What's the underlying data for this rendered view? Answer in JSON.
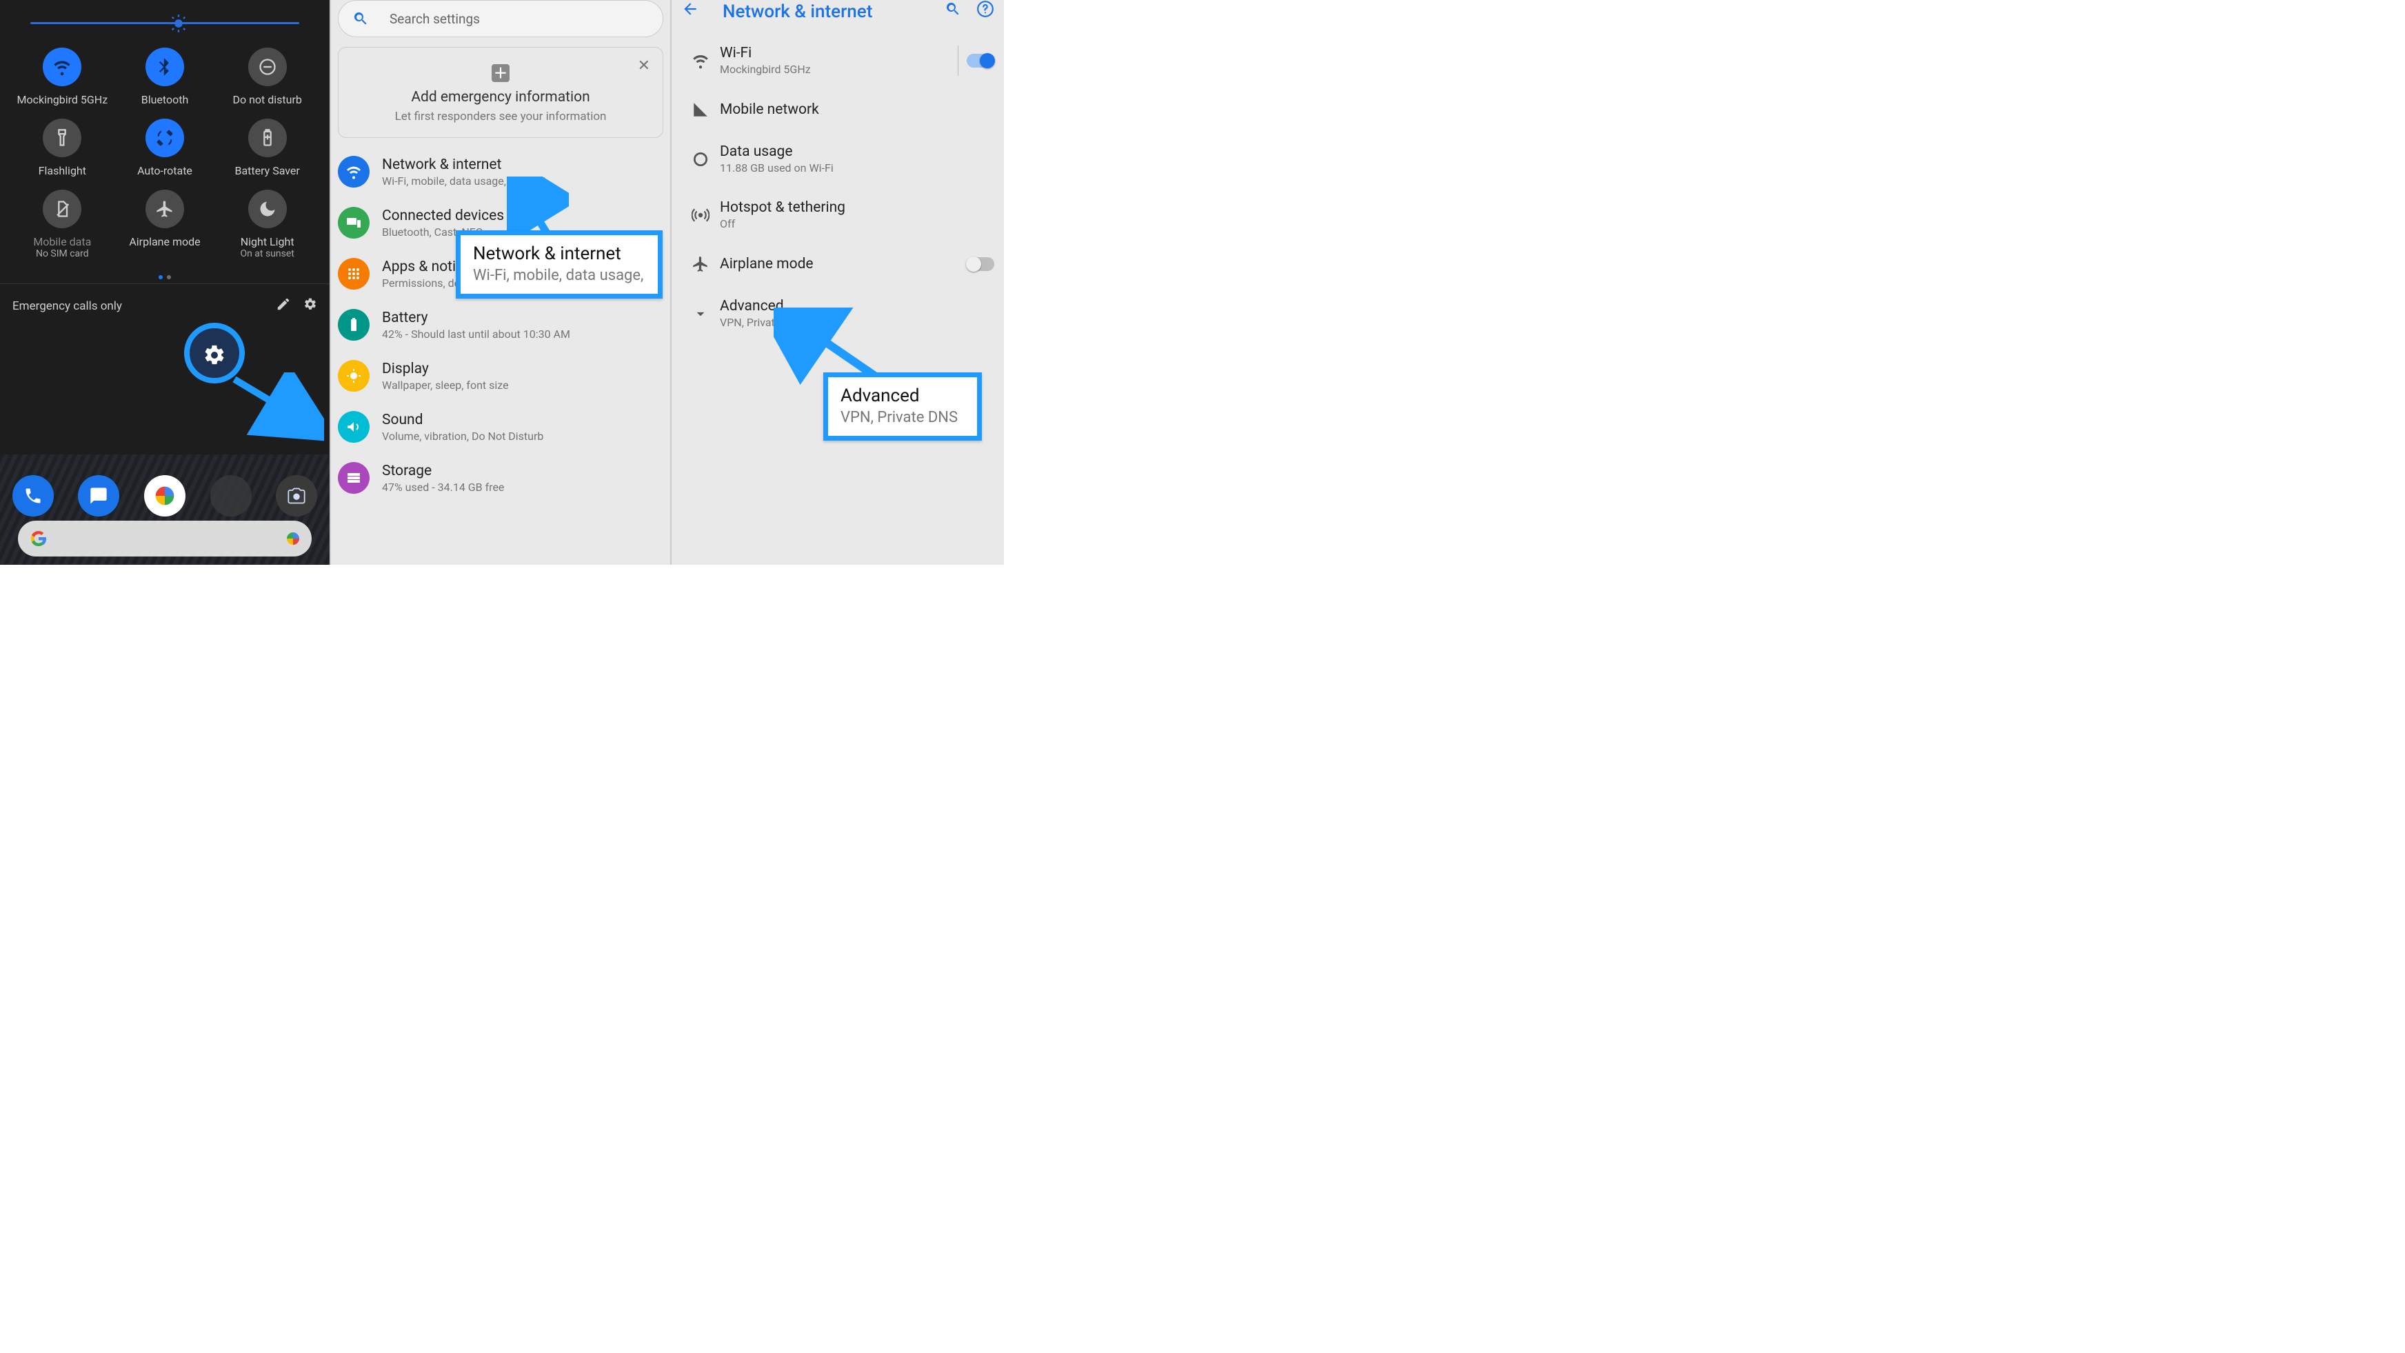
{
  "panel1": {
    "brightness_pct": 55,
    "tiles": [
      {
        "label": "Mockingbird 5GHz",
        "icon": "wifi",
        "on": true
      },
      {
        "label": "Bluetooth",
        "icon": "bluetooth",
        "on": true
      },
      {
        "label": "Do not disturb",
        "icon": "dnd",
        "on": false
      },
      {
        "label": "Flashlight",
        "icon": "flashlight",
        "on": false
      },
      {
        "label": "Auto-rotate",
        "icon": "autorotate",
        "on": true
      },
      {
        "label": "Battery Saver",
        "icon": "battery",
        "on": false
      },
      {
        "label": "Mobile data",
        "sub": "No SIM card",
        "icon": "sim",
        "on": false,
        "dim": true
      },
      {
        "label": "Airplane mode",
        "icon": "airplane",
        "on": false
      },
      {
        "label": "Night Light",
        "sub": "On at sunset",
        "icon": "moon",
        "on": false
      }
    ],
    "footer": "Emergency calls only"
  },
  "panel2": {
    "search_placeholder": "Search settings",
    "emergency": {
      "title": "Add emergency information",
      "subtitle": "Let first responders see your information"
    },
    "rows": [
      {
        "icon": "wifi",
        "color": "#1a73e8",
        "title": "Network & internet",
        "sub": "Wi-Fi, mobile, data usage, hotspot"
      },
      {
        "icon": "devices",
        "color": "#34a853",
        "title": "Connected devices",
        "sub": "Bluetooth, Cast, NFC"
      },
      {
        "icon": "apps",
        "color": "#f57c00",
        "title": "Apps & notifications",
        "sub": "Permissions, default apps"
      },
      {
        "icon": "battery-v",
        "color": "#009688",
        "title": "Battery",
        "sub": "42% - Should last until about 10:30 AM"
      },
      {
        "icon": "display",
        "color": "#fbbc05",
        "title": "Display",
        "sub": "Wallpaper, sleep, font size"
      },
      {
        "icon": "sound",
        "color": "#00bcd4",
        "title": "Sound",
        "sub": "Volume, vibration, Do Not Disturb"
      },
      {
        "icon": "storage",
        "color": "#ab47bc",
        "title": "Storage",
        "sub": "47% used - 34.14 GB free"
      }
    ]
  },
  "panel3": {
    "title": "Network & internet",
    "rows": [
      {
        "icon": "wifi-solid",
        "title": "Wi-Fi",
        "sub": "Mockingbird 5GHz",
        "toggle": true
      },
      {
        "icon": "cell",
        "title": "Mobile network"
      },
      {
        "icon": "datacircle",
        "title": "Data usage",
        "sub": "11.88 GB used on Wi-Fi"
      },
      {
        "icon": "hotspot",
        "title": "Hotspot & tethering",
        "sub": "Off"
      },
      {
        "icon": "airplane",
        "title": "Airplane mode",
        "toggle": false
      },
      {
        "icon": "chev",
        "title": "Advanced",
        "sub": "VPN, Private DNS"
      }
    ]
  },
  "callouts": {
    "c1": {
      "title": "Network & internet",
      "sub": "Wi-Fi, mobile, data usage,"
    },
    "c2": {
      "title": "Advanced",
      "sub": "VPN, Private DNS"
    }
  },
  "colors": {
    "accent_blue": "#1f9bff",
    "google_blue": "#1a73e8"
  }
}
